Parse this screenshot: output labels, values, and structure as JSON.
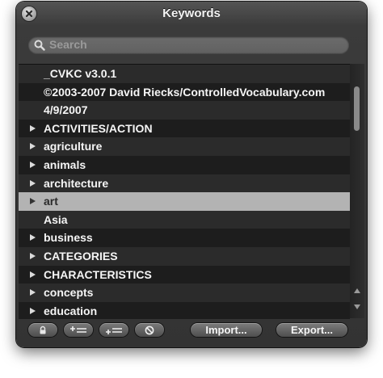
{
  "window": {
    "title": "Keywords"
  },
  "search": {
    "placeholder": "Search",
    "value": ""
  },
  "keywords": [
    {
      "label": "_CVKC v3.0.1",
      "expandable": false,
      "selected": false
    },
    {
      "label": "©2003-2007 David Riecks/ControlledVocabulary.com",
      "expandable": false,
      "selected": false
    },
    {
      "label": "4/9/2007",
      "expandable": false,
      "selected": false
    },
    {
      "label": "ACTIVITIES/ACTION",
      "expandable": true,
      "selected": false
    },
    {
      "label": "agriculture",
      "expandable": true,
      "selected": false
    },
    {
      "label": "animals",
      "expandable": true,
      "selected": false
    },
    {
      "label": "architecture",
      "expandable": true,
      "selected": false
    },
    {
      "label": "art",
      "expandable": true,
      "selected": true
    },
    {
      "label": "Asia",
      "expandable": false,
      "selected": false
    },
    {
      "label": "business",
      "expandable": true,
      "selected": false
    },
    {
      "label": "CATEGORIES",
      "expandable": true,
      "selected": false
    },
    {
      "label": "CHARACTERISTICS",
      "expandable": true,
      "selected": false
    },
    {
      "label": "concepts",
      "expandable": true,
      "selected": false
    },
    {
      "label": "education",
      "expandable": true,
      "selected": false
    }
  ],
  "footer": {
    "import_label": "Import...",
    "export_label": "Export..."
  },
  "icons": {
    "close": "close-icon",
    "search": "search-icon",
    "lock": "lock-icon",
    "add_child": "add-child-keyword-icon",
    "add": "add-keyword-icon",
    "remove": "remove-keyword-icon"
  },
  "colors": {
    "panel_bg": "#333333",
    "row_odd": "#2b2b2b",
    "row_even": "#1d1d1d",
    "row_selected": "#b3b3b3",
    "text": "#f5f5f5"
  }
}
